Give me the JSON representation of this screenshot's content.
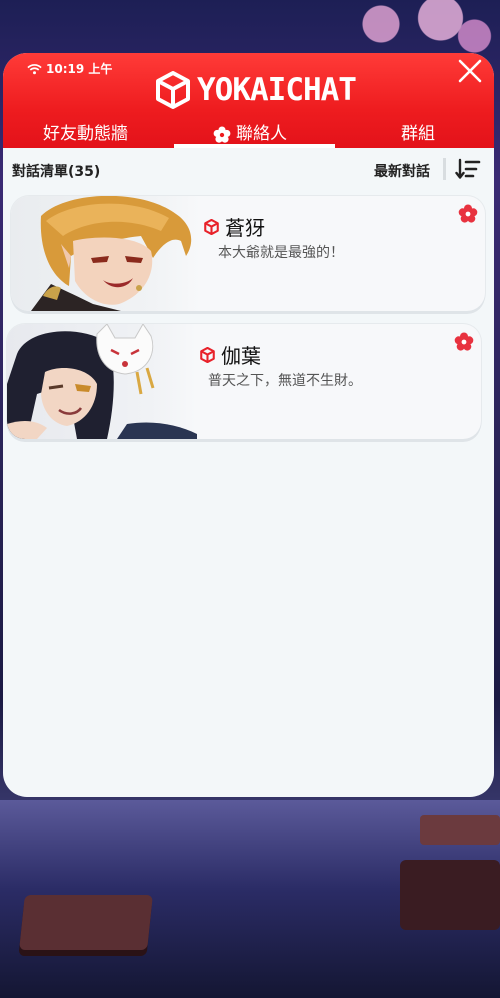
{
  "status_bar": {
    "time": "10:19 上午"
  },
  "app": {
    "title": "YOKAICHAT"
  },
  "tabs": [
    {
      "label": "好友動態牆"
    },
    {
      "label": "聯絡人"
    },
    {
      "label": "群組"
    }
  ],
  "list": {
    "title": "對話清單(35)",
    "sort_label": "最新對話"
  },
  "contacts": [
    {
      "name": "蒼犽",
      "message": "本大爺就是最強的！"
    },
    {
      "name": "伽葉",
      "message": "普天之下，無道不生財。"
    }
  ],
  "colors": {
    "accent": "#ee1c1f",
    "panel_bg": "#f3f7f9"
  }
}
